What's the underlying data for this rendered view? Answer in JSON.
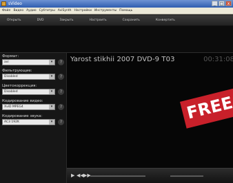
{
  "window": {
    "title": "sVideo",
    "controls": [
      "_",
      "□",
      "x"
    ]
  },
  "menu": [
    "Файл",
    "Видео",
    "Аудио",
    "Субтитры",
    "AviSynth",
    "Настройки",
    "Инструменты",
    "Помощь"
  ],
  "toolbar": [
    "Открыть",
    "DVD",
    "Закрыть",
    "Настроить",
    "Сохранить",
    "Конвертить"
  ],
  "sidebar": {
    "fields": [
      {
        "label": "Формат:",
        "value": "avi"
      },
      {
        "label": "Фильтрующие:",
        "value": "Disabled"
      },
      {
        "label": "Цветокоррекция:",
        "value": "Disabled"
      },
      {
        "label": "Кодирование видео:",
        "value": "XviD MPEG4"
      },
      {
        "label": "Кодирование звука:",
        "value": "AC3 192K"
      }
    ],
    "info_symbol": "?",
    "arrow_symbol": "▾"
  },
  "video": {
    "title": "Yarost stikhii 2007 DVD-9 T03",
    "time": "00:31:08"
  },
  "promo": {
    "text": "FREE",
    "color": "#c8202a"
  },
  "player": {
    "play": "▶",
    "prev": "◀◀",
    "next": "▶▶"
  }
}
